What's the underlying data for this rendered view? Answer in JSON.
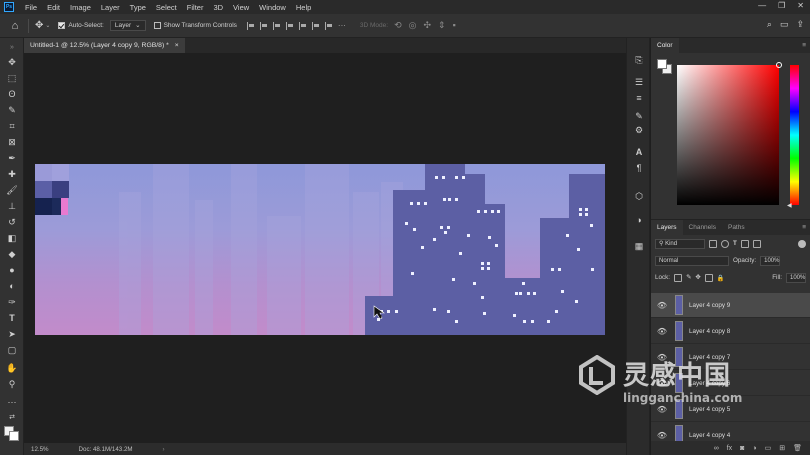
{
  "menu": [
    "File",
    "Edit",
    "Image",
    "Layer",
    "Type",
    "Select",
    "Filter",
    "3D",
    "View",
    "Window",
    "Help"
  ],
  "app_icon_text": "Ps",
  "options": {
    "auto_select_label": "Auto-Select:",
    "auto_select_value": "Layer",
    "show_transform_label": "Show Transform Controls",
    "mode_3d_label": "3D Mode:"
  },
  "document": {
    "tab_title": "Untitled-1 @ 12.5% (Layer 4 copy 9, RGB/8) *",
    "zoom": "12.5%",
    "doc_size": "Doc: 48.1M/143.2M"
  },
  "color_panel": {
    "title": "Color"
  },
  "layers_panel": {
    "tabs": [
      "Layers",
      "Channels",
      "Paths"
    ],
    "kind_label": "Kind",
    "blend_mode": "Normal",
    "opacity_label": "Opacity:",
    "opacity_value": "100%",
    "lock_label": "Lock:",
    "fill_label": "Fill:",
    "fill_value": "100%",
    "layers": [
      {
        "name": "Layer 4 copy 9",
        "selected": true
      },
      {
        "name": "Layer 4 copy 8",
        "selected": false
      },
      {
        "name": "Layer 4 copy 7",
        "selected": false
      },
      {
        "name": "Layer 4 copy 6",
        "selected": false
      },
      {
        "name": "Layer 4 copy 5",
        "selected": false
      },
      {
        "name": "Layer 4 copy 4",
        "selected": false
      }
    ]
  },
  "watermark": {
    "text_cn": "灵感中国",
    "text_en": "lingganchina.com"
  },
  "colors": {
    "sky_top": "#8e98d9",
    "sky_bottom": "#c28bca",
    "building": "#5c5fa4",
    "window": "#e8eaff",
    "ps_blue": "#31a8ff"
  }
}
